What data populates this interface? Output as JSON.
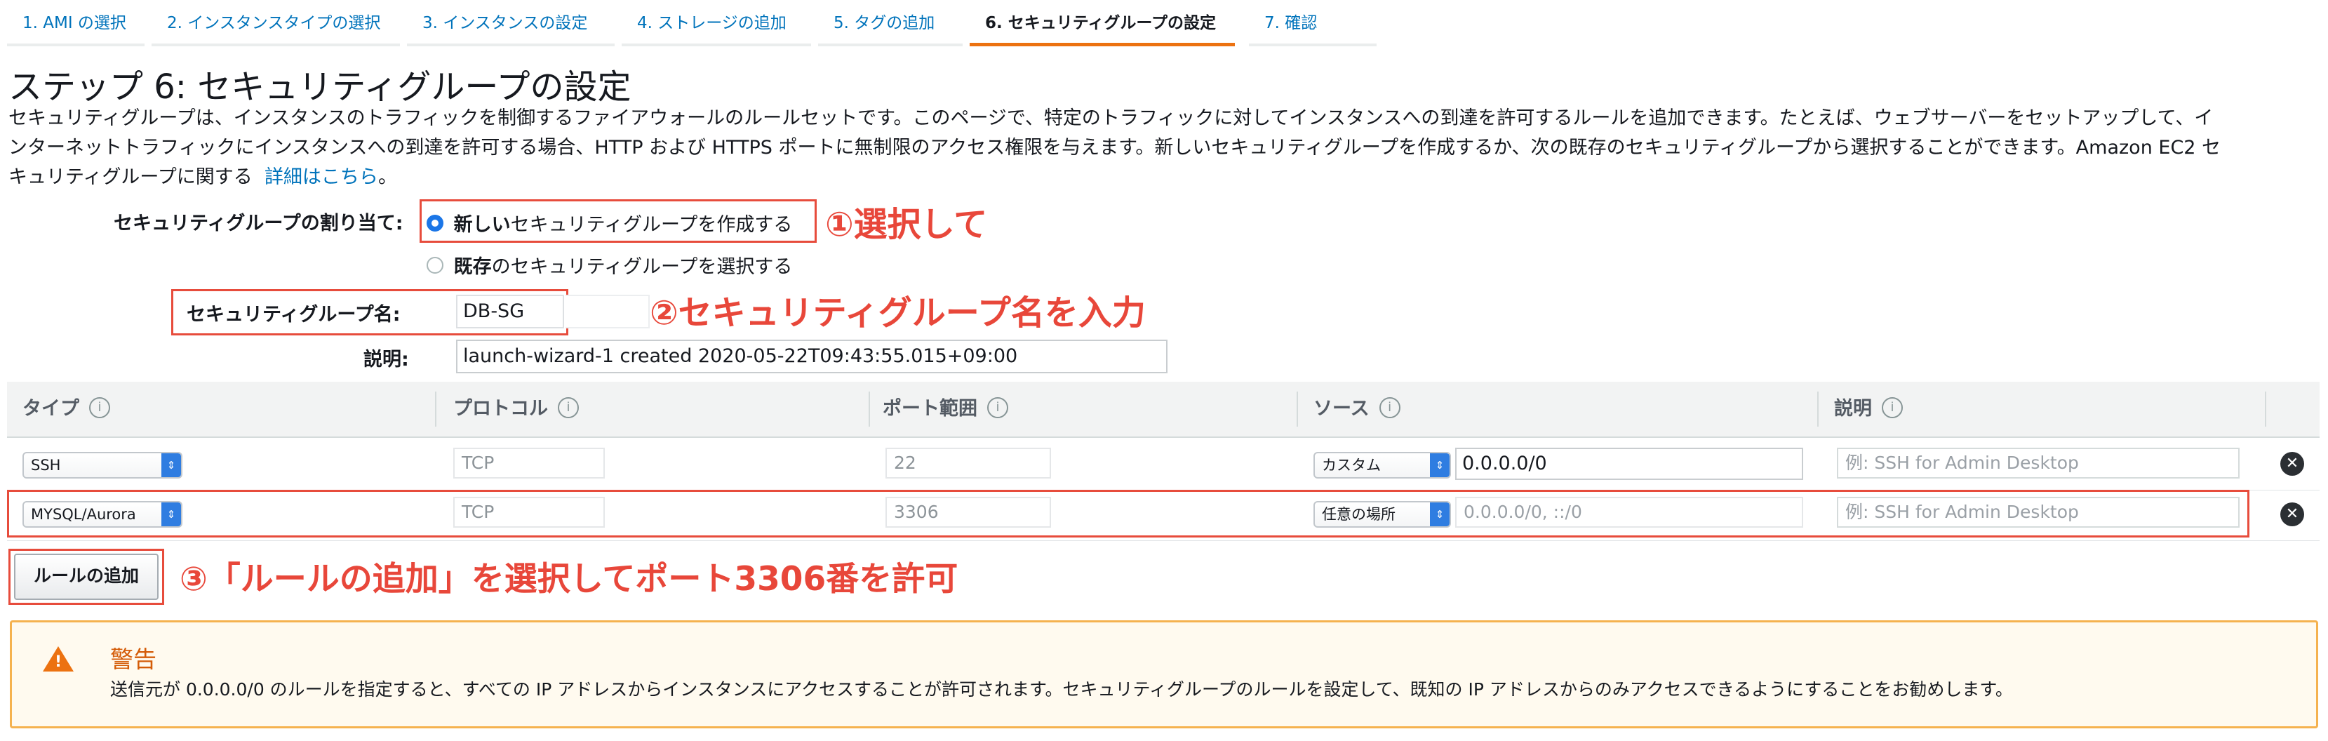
{
  "wizard_tabs": [
    {
      "label": "1. AMI の選択",
      "active": false
    },
    {
      "label": "2. インスタンスタイプの選択",
      "active": false
    },
    {
      "label": "3. インスタンスの設定",
      "active": false
    },
    {
      "label": "4. ストレージの追加",
      "active": false
    },
    {
      "label": "5. タグの追加",
      "active": false
    },
    {
      "label": "6. セキュリティグループの設定",
      "active": true
    },
    {
      "label": "7. 確認",
      "active": false
    }
  ],
  "page": {
    "title": "ステップ 6: セキュリティグループの設定",
    "intro_line1": "セキュリティグループは、インスタンスのトラフィックを制御するファイアウォールのルールセットです。このページで、特定のトラフィックに対してインスタンスへの到達を許可するルールを追加できます。たとえば、ウェブサーバーをセットアップして、イ",
    "intro_line2": "ンターネットトラフィックにインスタンスへの到達を許可する場合、HTTP および HTTPS ポートに無制限のアクセス権限を与えます。新しいセキュリティグループを作成するか、次の既存のセキュリティグループから選択することができます。Amazon EC2 セ",
    "intro_line3": "キュリティグループに関する",
    "learn_more": "詳細はこちら",
    "intro_end": "。"
  },
  "assign": {
    "label": "セキュリティグループの割り当て:",
    "new_bold": "新しい",
    "new_rest": "セキュリティグループを作成する",
    "existing_bold": "既存",
    "existing_rest": "のセキュリティグループを選択する",
    "selected": "new"
  },
  "sg": {
    "name_label": "セキュリティグループ名:",
    "name_value": "DB-SG",
    "desc_label": "説明:",
    "desc_value": "launch-wizard-1 created 2020-05-22T09:43:55.015+09:00"
  },
  "table": {
    "headers": [
      "タイプ",
      "プロトコル",
      "ポート範囲",
      "ソース",
      "説明"
    ],
    "info_icon": "i",
    "rows": [
      {
        "type": "SSH",
        "protocol": "TCP",
        "port": "22",
        "source_mode": "カスタム",
        "source": "0.0.0.0/0",
        "source_is_placeholder": false,
        "desc_placeholder": "例: SSH for Admin Desktop"
      },
      {
        "type": "MYSQL/Aurora",
        "protocol": "TCP",
        "port": "3306",
        "source_mode": "任意の場所",
        "source": "0.0.0.0/0, ::/0",
        "source_is_placeholder": true,
        "desc_placeholder": "例: SSH for Admin Desktop"
      }
    ]
  },
  "add_rule_button": "ルールの追加",
  "annotations": {
    "a1": "①選択して",
    "a2": "②セキュリティグループ名を入力",
    "a3": "③「ルールの追加」を選択してポート3306番を許可"
  },
  "warning": {
    "title": "警告",
    "body": "送信元が 0.0.0.0/0 のルールを指定すると、すべての IP アドレスからインスタンスにアクセスすることが許可されます。セキュリティグループのルールを設定して、既知の IP アドレスからのみアクセスできるようにすることをお勧めします。",
    "icon_glyph": "!"
  },
  "colors": {
    "accent_tab": "#ec7211",
    "link": "#0073bb",
    "annotation": "#e8473a",
    "warning_border": "#f5b24f",
    "radio_checked": "#1b76e7"
  }
}
